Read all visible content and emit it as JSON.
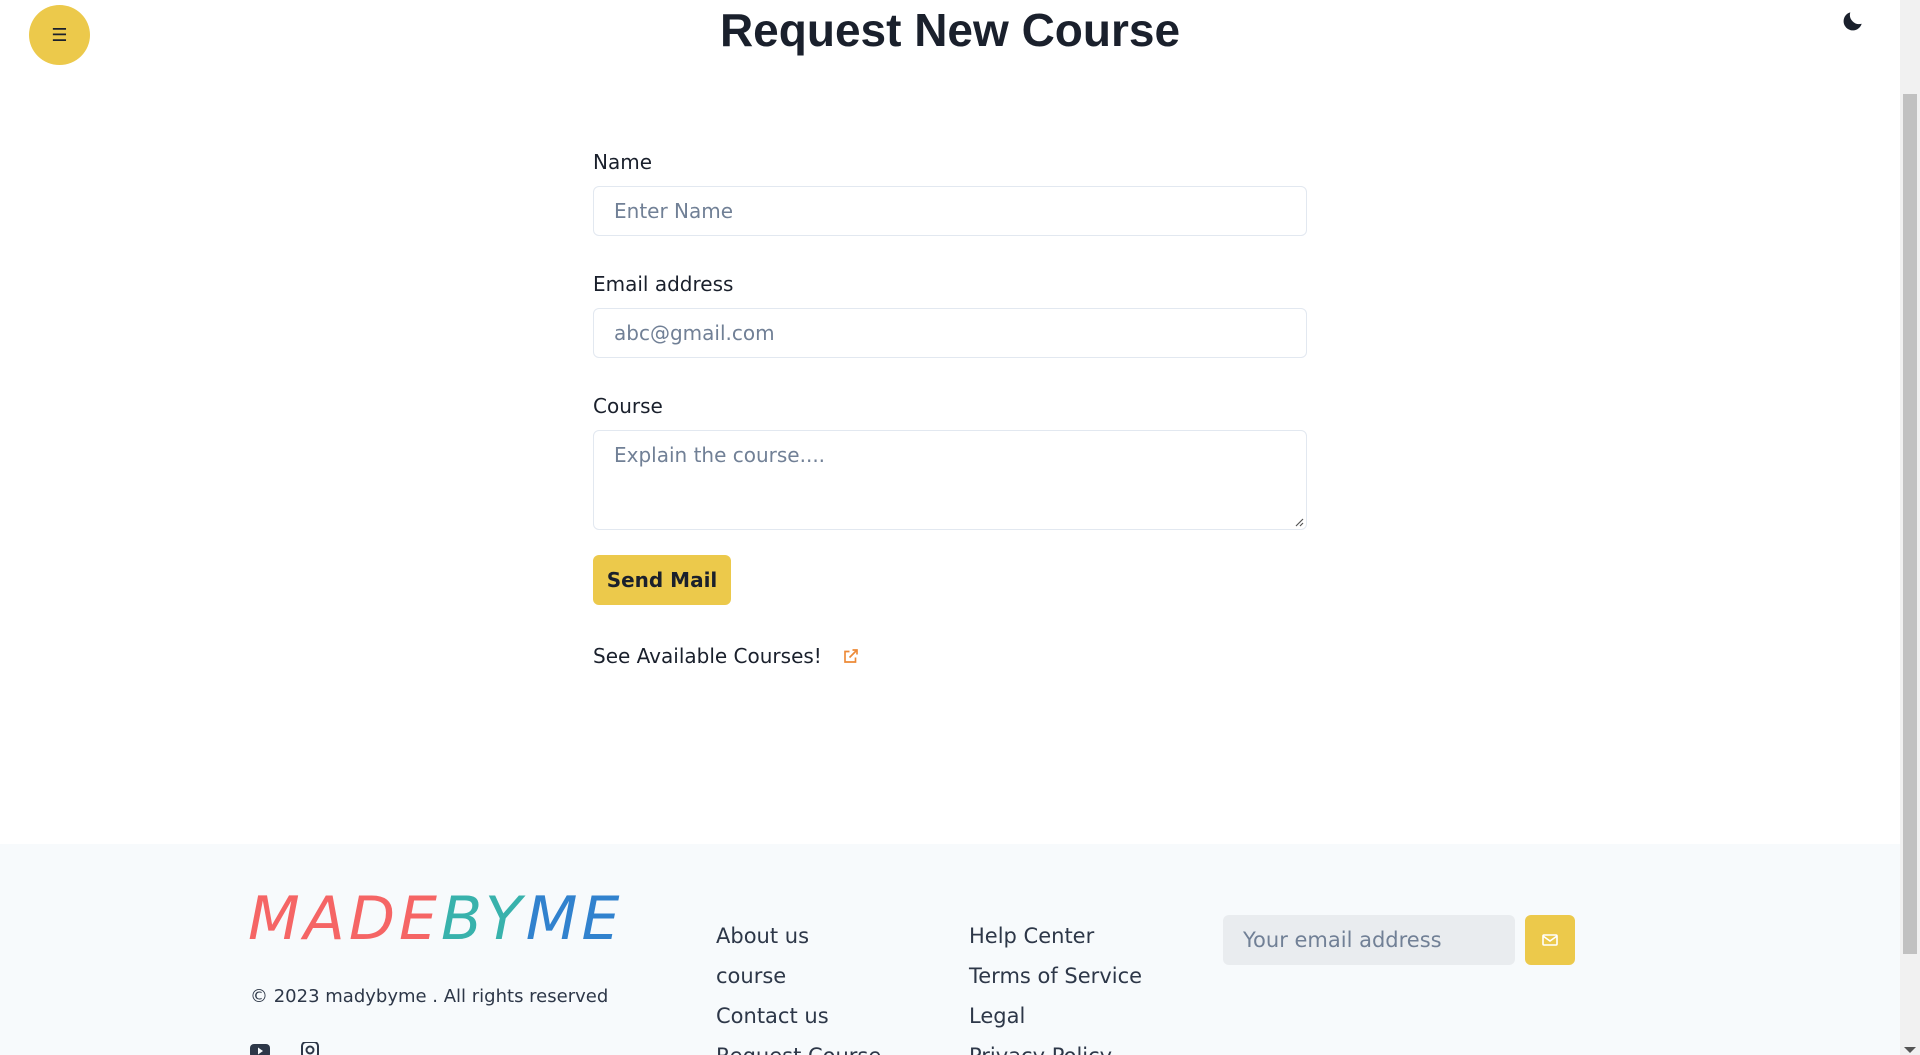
{
  "header": {
    "title": "Request New Course",
    "menu_icon": "☰"
  },
  "form": {
    "name_label": "Name",
    "name_placeholder": "Enter Name",
    "email_label": "Email address",
    "email_placeholder": "abc@gmail.com",
    "course_label": "Course",
    "course_placeholder": "Explain the course....",
    "submit_label": "Send Mail",
    "available_link": "See Available Courses!"
  },
  "footer": {
    "logo": {
      "part1": "MADE",
      "part2": "BY",
      "part3": "ME"
    },
    "copyright": "© 2023 madybyme . All rights reserved",
    "col1": [
      "About us",
      "course",
      "Contact us",
      "Request Course"
    ],
    "col2": [
      "Help Center",
      "Terms of Service",
      "Legal",
      "Privacy Policy"
    ],
    "newsletter_placeholder": "Your email address"
  },
  "colors": {
    "accent": "#ecc94b",
    "text": "#1a202c",
    "footer_bg": "#f7fafc",
    "logo_red": "#f56565",
    "logo_teal": "#38b2ac",
    "logo_blue": "#3182ce"
  },
  "icons": {
    "menu": "hamburger-icon",
    "theme": "moon-icon",
    "link": "external-link-icon",
    "send": "mail-icon",
    "social": [
      "youtube-icon",
      "instagram-icon"
    ]
  }
}
